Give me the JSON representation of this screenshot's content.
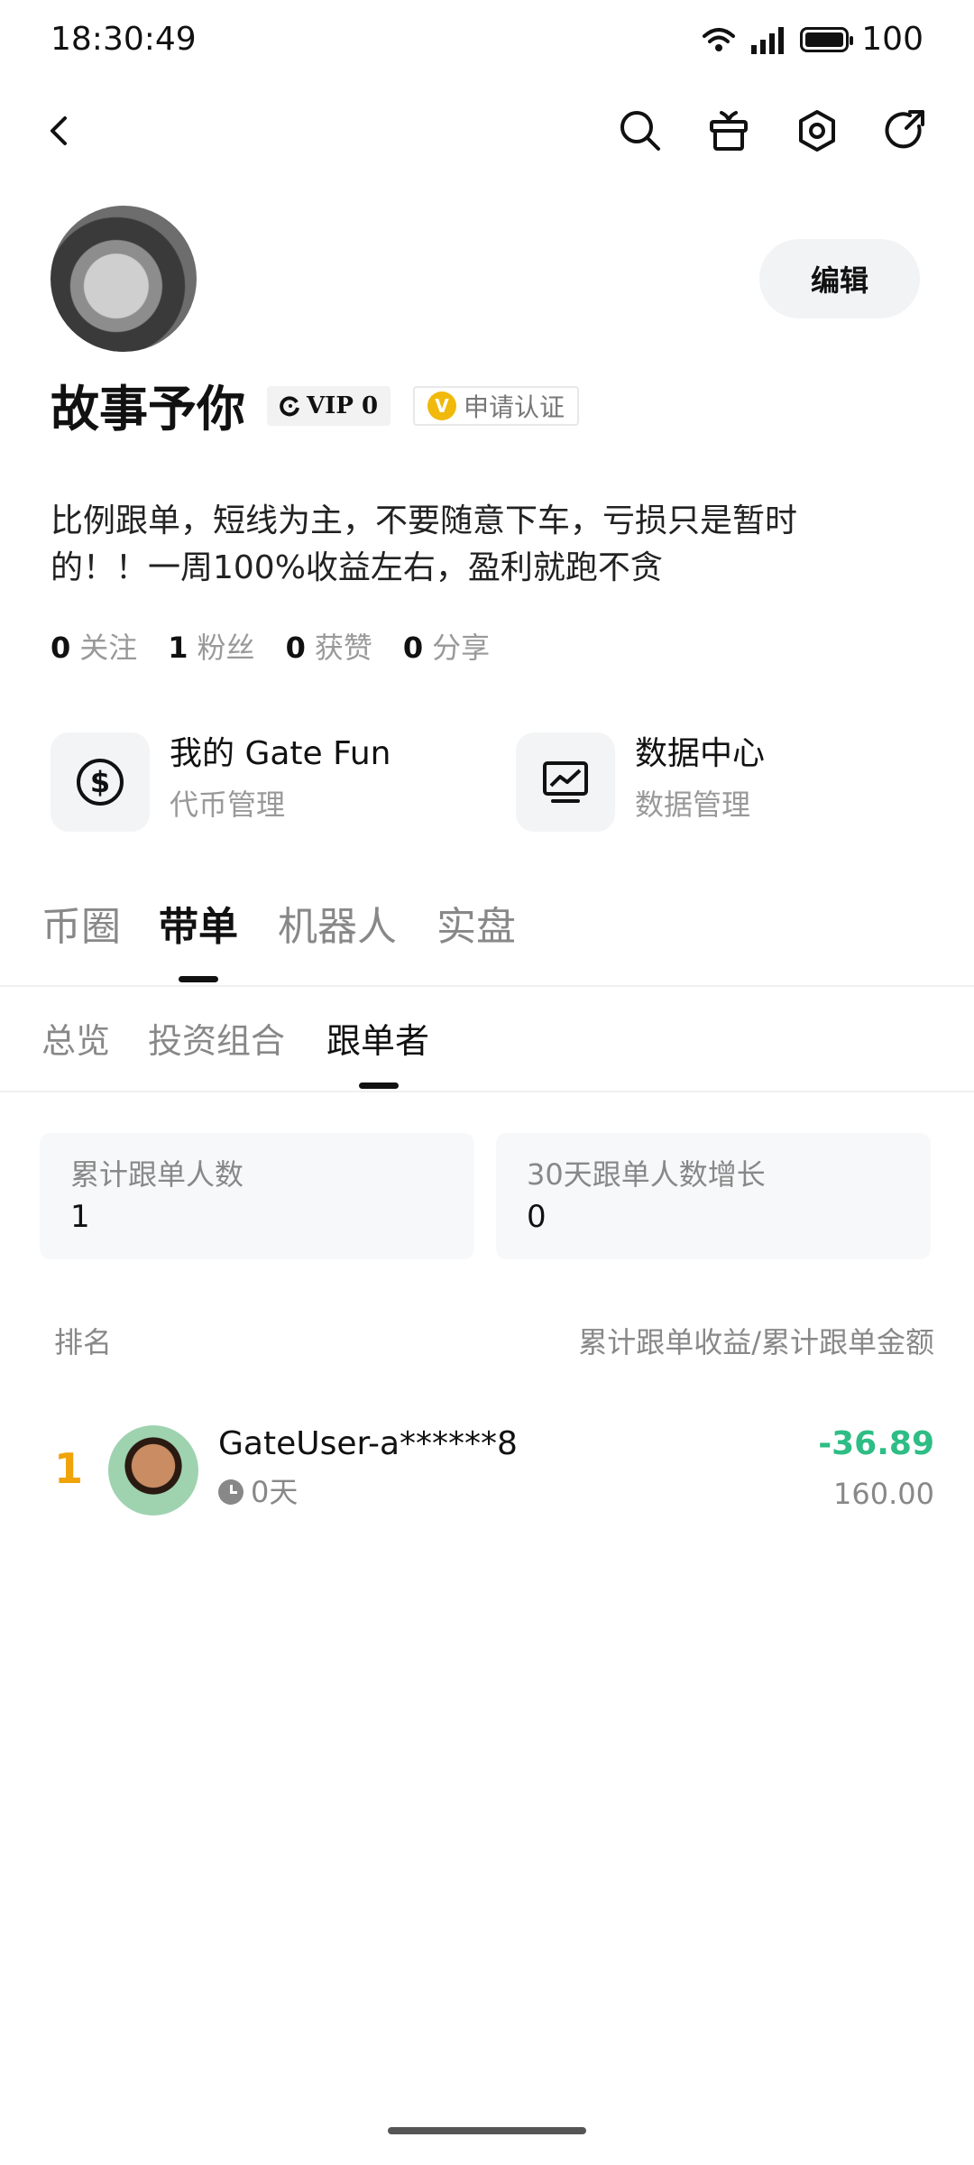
{
  "status_bar": {
    "time": "18:30:49",
    "battery": "100"
  },
  "nav": {
    "icons": [
      "back-icon",
      "search-icon",
      "gift-icon",
      "settings-icon",
      "share-icon"
    ]
  },
  "profile": {
    "edit_label": "编辑",
    "username": "故事予你",
    "vip_label": "VIP 0",
    "verify_label": "申请认证",
    "verify_mark": "V",
    "bio": "比例跟单，短线为主，不要随意下车，亏损只是暂时的！！一周100%收益左右，盈利就跑不贪",
    "stats": [
      {
        "num": "0",
        "label": "关注"
      },
      {
        "num": "1",
        "label": "粉丝"
      },
      {
        "num": "0",
        "label": "获赞"
      },
      {
        "num": "0",
        "label": "分享"
      }
    ]
  },
  "features": [
    {
      "title": "我的 Gate Fun",
      "subtitle": "代币管理",
      "icon": "dollar-icon"
    },
    {
      "title": "数据中心",
      "subtitle": "数据管理",
      "icon": "chart-monitor-icon"
    }
  ],
  "main_tabs": [
    "币圈",
    "带单",
    "机器人",
    "实盘"
  ],
  "main_tab_active": "带单",
  "sub_tabs": [
    "总览",
    "投资组合",
    "跟单者"
  ],
  "sub_tab_active": "跟单者",
  "summary": [
    {
      "label": "累计跟单人数",
      "value": "1"
    },
    {
      "label": "30天跟单人数增长",
      "value": "0"
    }
  ],
  "list": {
    "col_rank": "排名",
    "col_value": "累计跟单收益/累计跟单金额",
    "rows": [
      {
        "rank": "1",
        "name": "GateUser-a******8",
        "days": "0天",
        "pnl": "-36.89",
        "amount": "160.00"
      }
    ]
  },
  "colors": {
    "accent_gold": "#f0a30a",
    "profit_green": "#2ebd85",
    "verify_gold": "#f0b90b"
  }
}
